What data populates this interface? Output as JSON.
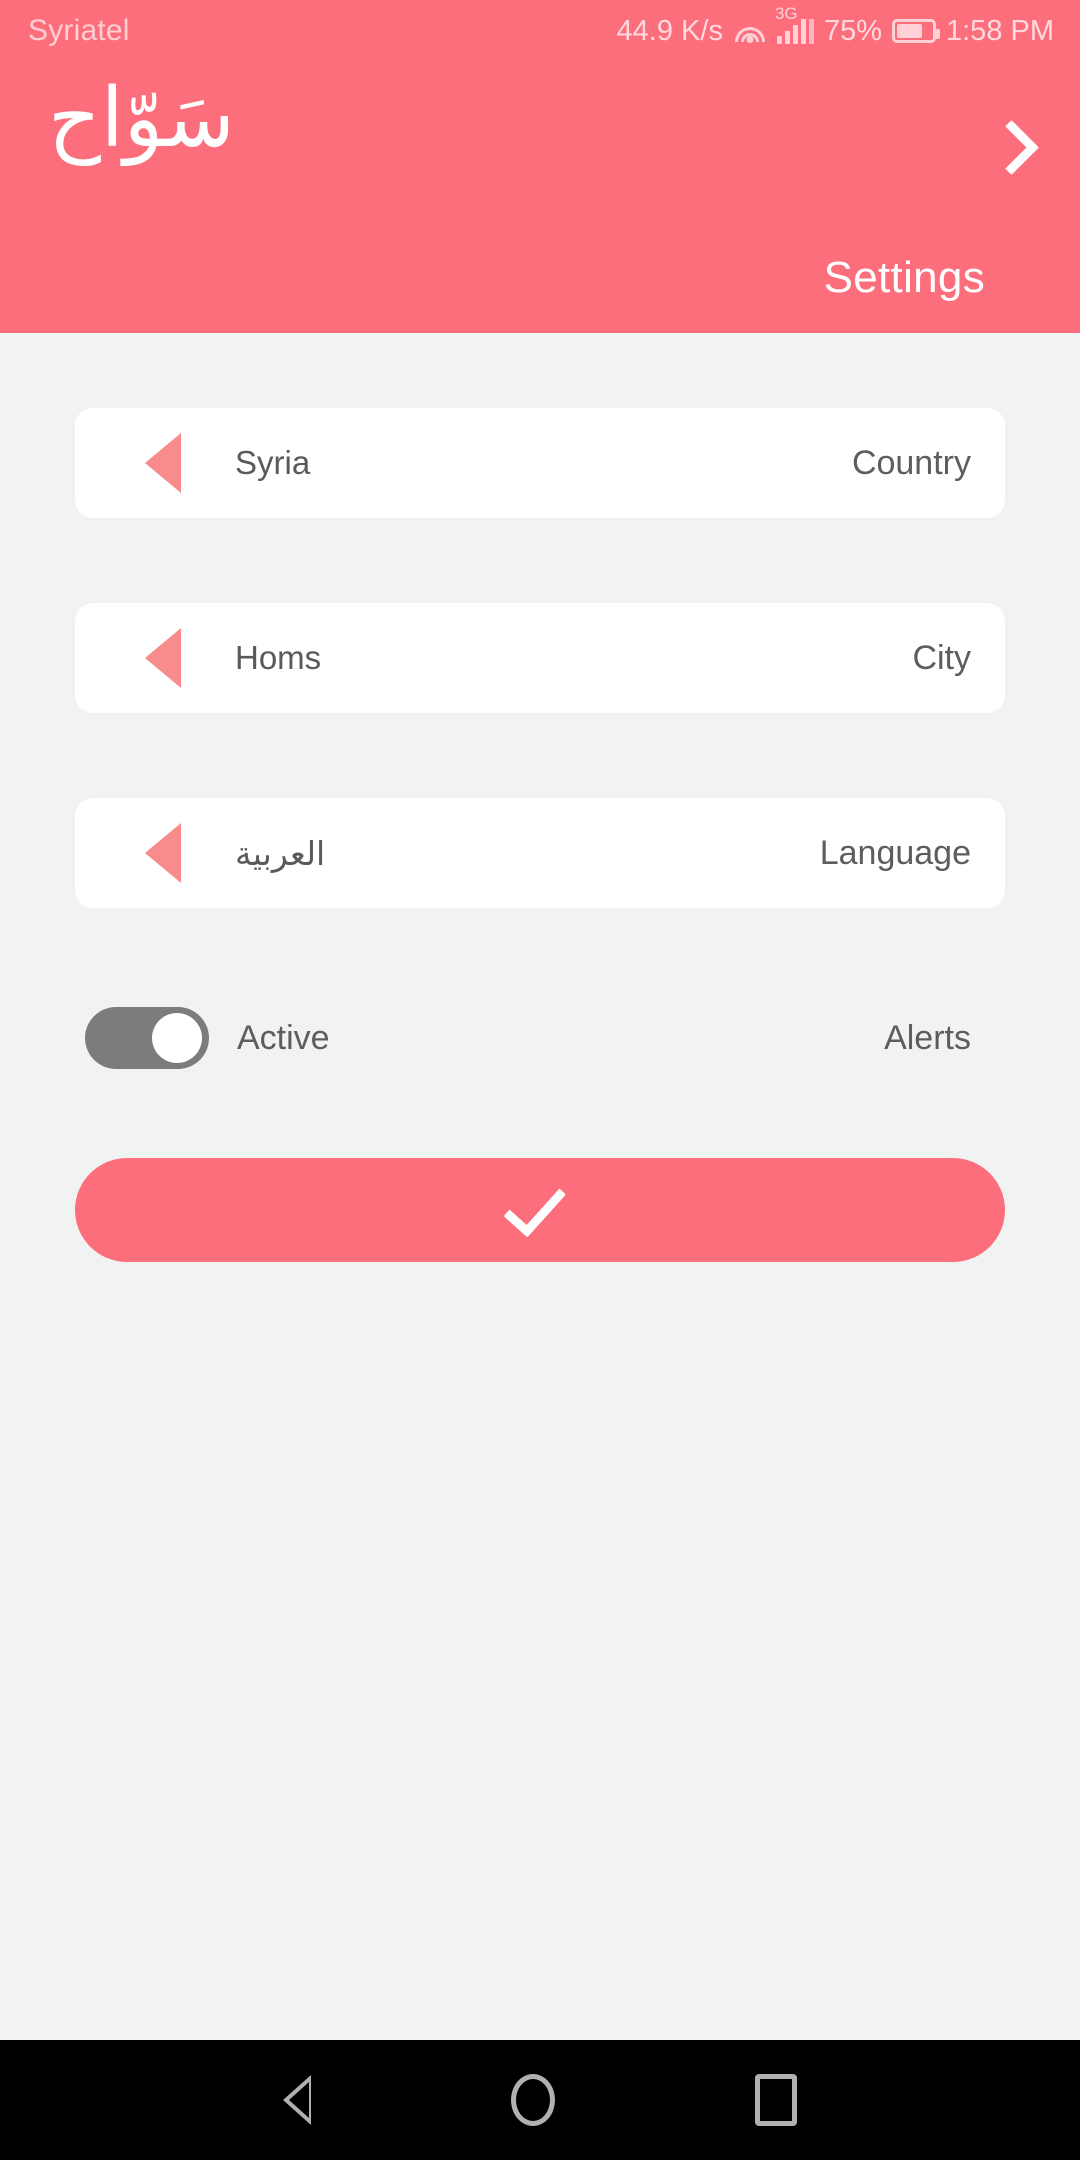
{
  "status_bar": {
    "carrier": "Syriatel",
    "network_speed": "44.9 K/s",
    "wifi_icon": "wifi-icon",
    "network_type": "3G",
    "signal_icon": "signal-bars-icon",
    "battery_percent": "75%",
    "battery_icon": "battery-icon",
    "time": "1:58 PM"
  },
  "header": {
    "logo_text": "سَوّاح",
    "forward_icon": "chevron-right-icon",
    "title": "Settings",
    "background_color": "#fc6e7c"
  },
  "settings": {
    "rows": [
      {
        "label": "Country",
        "value": "Syria",
        "arrow_icon": "triangle-left-icon",
        "rtl": false
      },
      {
        "label": "City",
        "value": "Homs",
        "arrow_icon": "triangle-left-icon",
        "rtl": false
      },
      {
        "label": "Language",
        "value": "العربية",
        "arrow_icon": "triangle-left-icon",
        "rtl": true
      }
    ],
    "alerts": {
      "label": "Alerts",
      "state_text": "Active",
      "toggle_on": true,
      "toggle_track_color": "#7c7c7c",
      "toggle_knob_color": "#ffffff"
    },
    "confirm_button": {
      "icon": "check-icon",
      "color": "#fc6e7c"
    }
  },
  "navigation_bar": {
    "back": "back-triangle-icon",
    "home": "home-circle-icon",
    "recents": "recents-square-icon"
  },
  "colors": {
    "accent": "#fc6e7c",
    "page_background": "#f1f3f2",
    "card_background": "#ffffff",
    "text": "#5d5d5d",
    "triangle": "#f88b8b"
  }
}
